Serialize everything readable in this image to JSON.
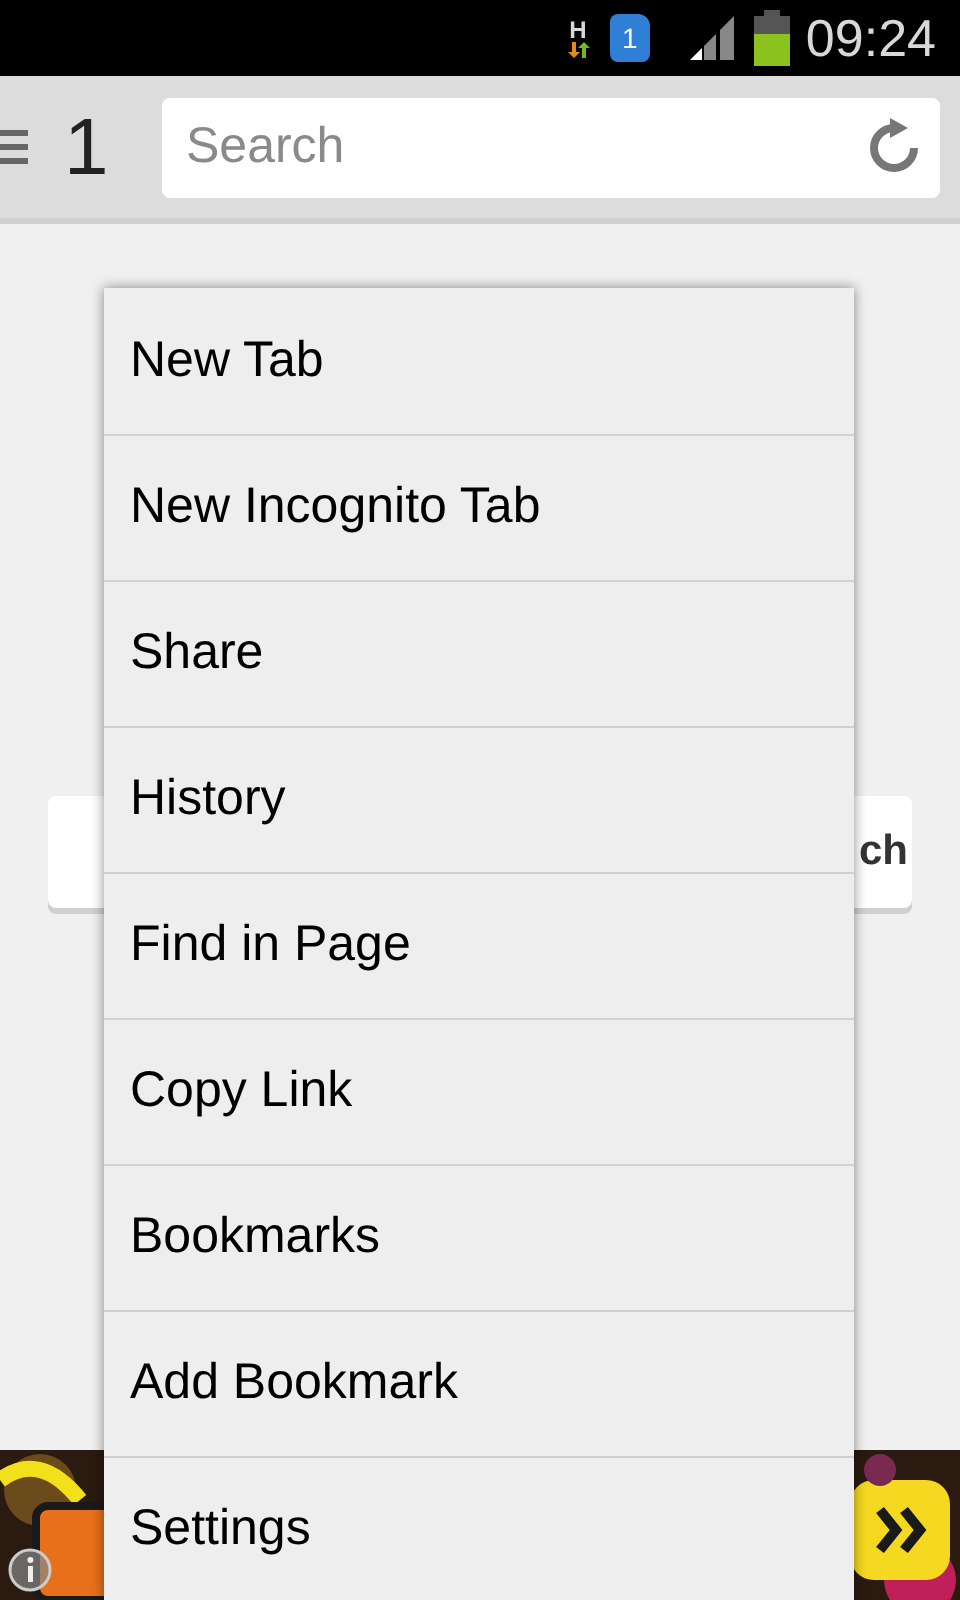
{
  "status_bar": {
    "network": "H",
    "sim": "1",
    "time": "09:24"
  },
  "toolbar": {
    "tab_count": "1",
    "search": {
      "placeholder": "Search"
    }
  },
  "page": {
    "button_text": "ch"
  },
  "menu": {
    "items": [
      {
        "label": "New Tab"
      },
      {
        "label": "New Incognito Tab"
      },
      {
        "label": "Share"
      },
      {
        "label": "History"
      },
      {
        "label": "Find in Page"
      },
      {
        "label": "Copy Link"
      },
      {
        "label": "Bookmarks"
      },
      {
        "label": "Add Bookmark"
      },
      {
        "label": "Settings"
      }
    ]
  }
}
